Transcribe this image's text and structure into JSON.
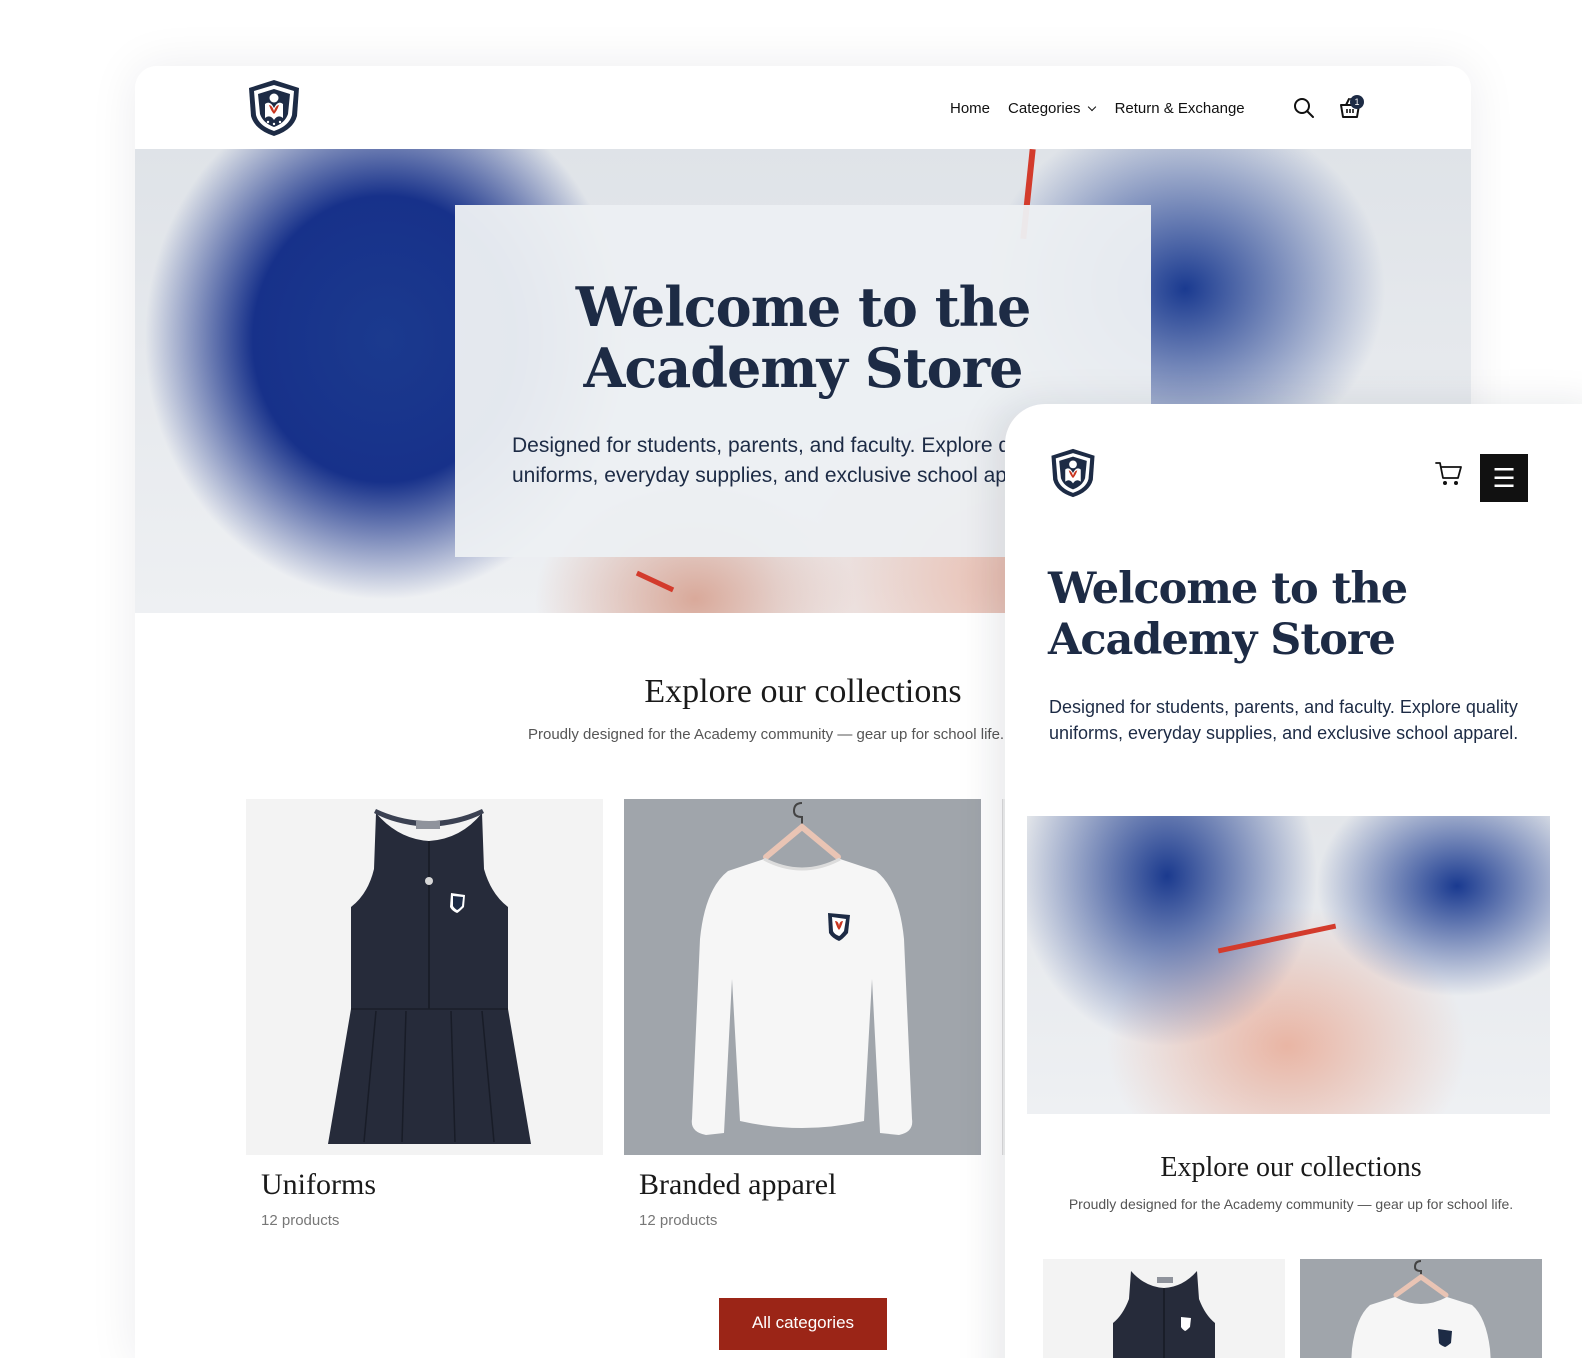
{
  "brand": {
    "navy": "#1d2b45",
    "accent_red": "#9b2517",
    "logo_icon": "academy-shield-icon"
  },
  "desktop": {
    "nav": {
      "home": "Home",
      "categories": "Categories",
      "return_exchange": "Return & Exchange",
      "cart_count": "1"
    },
    "hero": {
      "title": "Welcome to the Academy Store",
      "subtitle": "Designed for students, parents, and faculty. Explore quality uniforms, everyday supplies, and exclusive school apparel."
    },
    "collections": {
      "title": "Explore our collections",
      "subtitle": "Proudly designed for the Academy community — gear up for school life.",
      "cards": [
        {
          "title": "Uniforms",
          "count": "12 products"
        },
        {
          "title": "Branded apparel",
          "count": "12 products"
        }
      ],
      "button": "All categories"
    }
  },
  "mobile": {
    "hero": {
      "title": "Welcome to the Academy Store",
      "subtitle": "Designed for students, parents, and faculty. Explore quality uniforms, everyday supplies, and exclusive school apparel."
    },
    "collections": {
      "title": "Explore our collections",
      "subtitle": "Proudly designed for the Academy community — gear up for school life."
    },
    "menu_icon": "☰"
  }
}
